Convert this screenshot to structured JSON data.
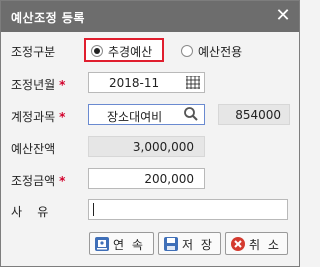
{
  "dialog": {
    "title": "예산조정 등록",
    "close_glyph": "✕"
  },
  "fields": {
    "adj_type": {
      "label": "조정구분",
      "options": [
        "추경예산",
        "예산전용"
      ],
      "selected": "추경예산"
    },
    "adj_date": {
      "label": "조정년월",
      "value": "2018-11"
    },
    "account": {
      "label": "계정과목",
      "name": "장소대여비",
      "code": "854000"
    },
    "balance": {
      "label": "예산잔액",
      "value": "3,000,000"
    },
    "amount": {
      "label": "조정금액",
      "value": "200,000"
    },
    "reason": {
      "label": "사    유",
      "value": ""
    }
  },
  "required_mark": "*",
  "buttons": {
    "continue": "연 속",
    "save": "저 장",
    "cancel": "취 소"
  },
  "colors": {
    "titlebar": "#6d6d6d",
    "highlight": "#e01e2e",
    "required": "#d2002b"
  }
}
